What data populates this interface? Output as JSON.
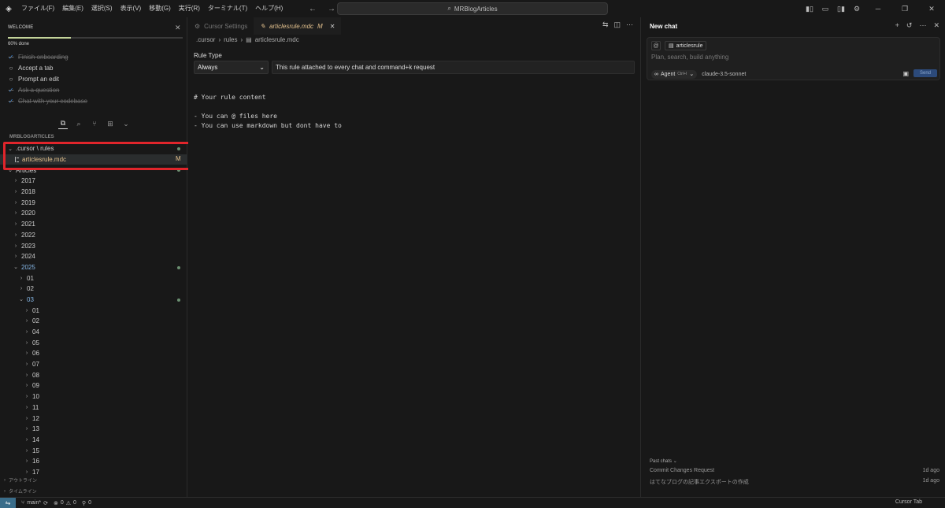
{
  "titlebar": {
    "menus": [
      "ファイル(F)",
      "編集(E)",
      "選択(S)",
      "表示(V)",
      "移動(G)",
      "実行(R)",
      "ターミナル(T)",
      "ヘルプ(H)"
    ],
    "search_text": "MRBlogArticles"
  },
  "welcome": {
    "title": "WELCOME",
    "progress_percent": 60,
    "progress_text": "60% done",
    "items": [
      {
        "label": "Finish onboarding",
        "done": true
      },
      {
        "label": "Accept a tab",
        "done": false
      },
      {
        "label": "Prompt an edit",
        "done": false
      },
      {
        "label": "Ask a question",
        "done": true
      },
      {
        "label": "Chat with your codebase",
        "done": true
      }
    ]
  },
  "explorer": {
    "header": "MRBLOGARTICLES",
    "rows": [
      {
        "label": ".cursor \\ rules",
        "indent": 0,
        "chevron": "open",
        "dot": true
      },
      {
        "label": "articlesrule.mdc",
        "indent": 1,
        "file": true,
        "badge": "M",
        "selected": true
      },
      {
        "label": "Articles",
        "indent": 0,
        "chevron": "open",
        "dot": true
      },
      {
        "label": "2017",
        "indent": 1,
        "chevron": "closed"
      },
      {
        "label": "2018",
        "indent": 1,
        "chevron": "closed"
      },
      {
        "label": "2019",
        "indent": 1,
        "chevron": "closed"
      },
      {
        "label": "2020",
        "indent": 1,
        "chevron": "closed"
      },
      {
        "label": "2021",
        "indent": 1,
        "chevron": "closed"
      },
      {
        "label": "2022",
        "indent": 1,
        "chevron": "closed"
      },
      {
        "label": "2023",
        "indent": 1,
        "chevron": "closed"
      },
      {
        "label": "2024",
        "indent": 1,
        "chevron": "closed"
      },
      {
        "label": "2025",
        "indent": 1,
        "chevron": "open",
        "dot": true,
        "blue": true
      },
      {
        "label": "01",
        "indent": 2,
        "chevron": "closed"
      },
      {
        "label": "02",
        "indent": 2,
        "chevron": "closed"
      },
      {
        "label": "03",
        "indent": 2,
        "chevron": "open",
        "dot": true,
        "blue": true
      },
      {
        "label": "01",
        "indent": 3,
        "chevron": "closed"
      },
      {
        "label": "02",
        "indent": 3,
        "chevron": "closed"
      },
      {
        "label": "04",
        "indent": 3,
        "chevron": "closed"
      },
      {
        "label": "05",
        "indent": 3,
        "chevron": "closed"
      },
      {
        "label": "06",
        "indent": 3,
        "chevron": "closed"
      },
      {
        "label": "07",
        "indent": 3,
        "chevron": "closed"
      },
      {
        "label": "08",
        "indent": 3,
        "chevron": "closed"
      },
      {
        "label": "09",
        "indent": 3,
        "chevron": "closed"
      },
      {
        "label": "10",
        "indent": 3,
        "chevron": "closed"
      },
      {
        "label": "11",
        "indent": 3,
        "chevron": "closed"
      },
      {
        "label": "12",
        "indent": 3,
        "chevron": "closed"
      },
      {
        "label": "13",
        "indent": 3,
        "chevron": "closed"
      },
      {
        "label": "14",
        "indent": 3,
        "chevron": "closed"
      },
      {
        "label": "15",
        "indent": 3,
        "chevron": "closed"
      },
      {
        "label": "16",
        "indent": 3,
        "chevron": "closed"
      },
      {
        "label": "17",
        "indent": 3,
        "chevron": "closed"
      }
    ],
    "outline_label": "アウトライン",
    "timeline_label": "タイムライン"
  },
  "editor": {
    "tabs": [
      {
        "label": "Cursor Settings",
        "active": false
      },
      {
        "label": "articlesrule.mdc",
        "badge": "M",
        "active": true
      }
    ],
    "breadcrumb": [
      ".cursor",
      "rules",
      "articlesrule.mdc"
    ],
    "rule_type_label": "Rule Type",
    "rule_type_value": "Always",
    "rule_description": "This rule attached to every chat and command+k request",
    "code_lines": [
      "# Your rule content",
      "",
      "- You can @ files here",
      "- You can use markdown but dont have to"
    ]
  },
  "chat": {
    "title": "New chat",
    "context_file": "articlesrule",
    "placeholder": "Plan, search, build anything",
    "mode": "Agent",
    "mode_shortcut": "Ctrl+I",
    "model": "claude-3.5-sonnet",
    "send_label": "Send",
    "past_title": "Past chats",
    "past_chats": [
      {
        "title": "Commit Changes Request",
        "time": "1d ago"
      },
      {
        "title": "はてなブログの記事エクスポートの作成",
        "time": "1d ago"
      }
    ]
  },
  "statusbar": {
    "branch": "main*",
    "errors": "0",
    "warnings": "0",
    "ports": "0",
    "right_label": "Cursor Tab"
  }
}
